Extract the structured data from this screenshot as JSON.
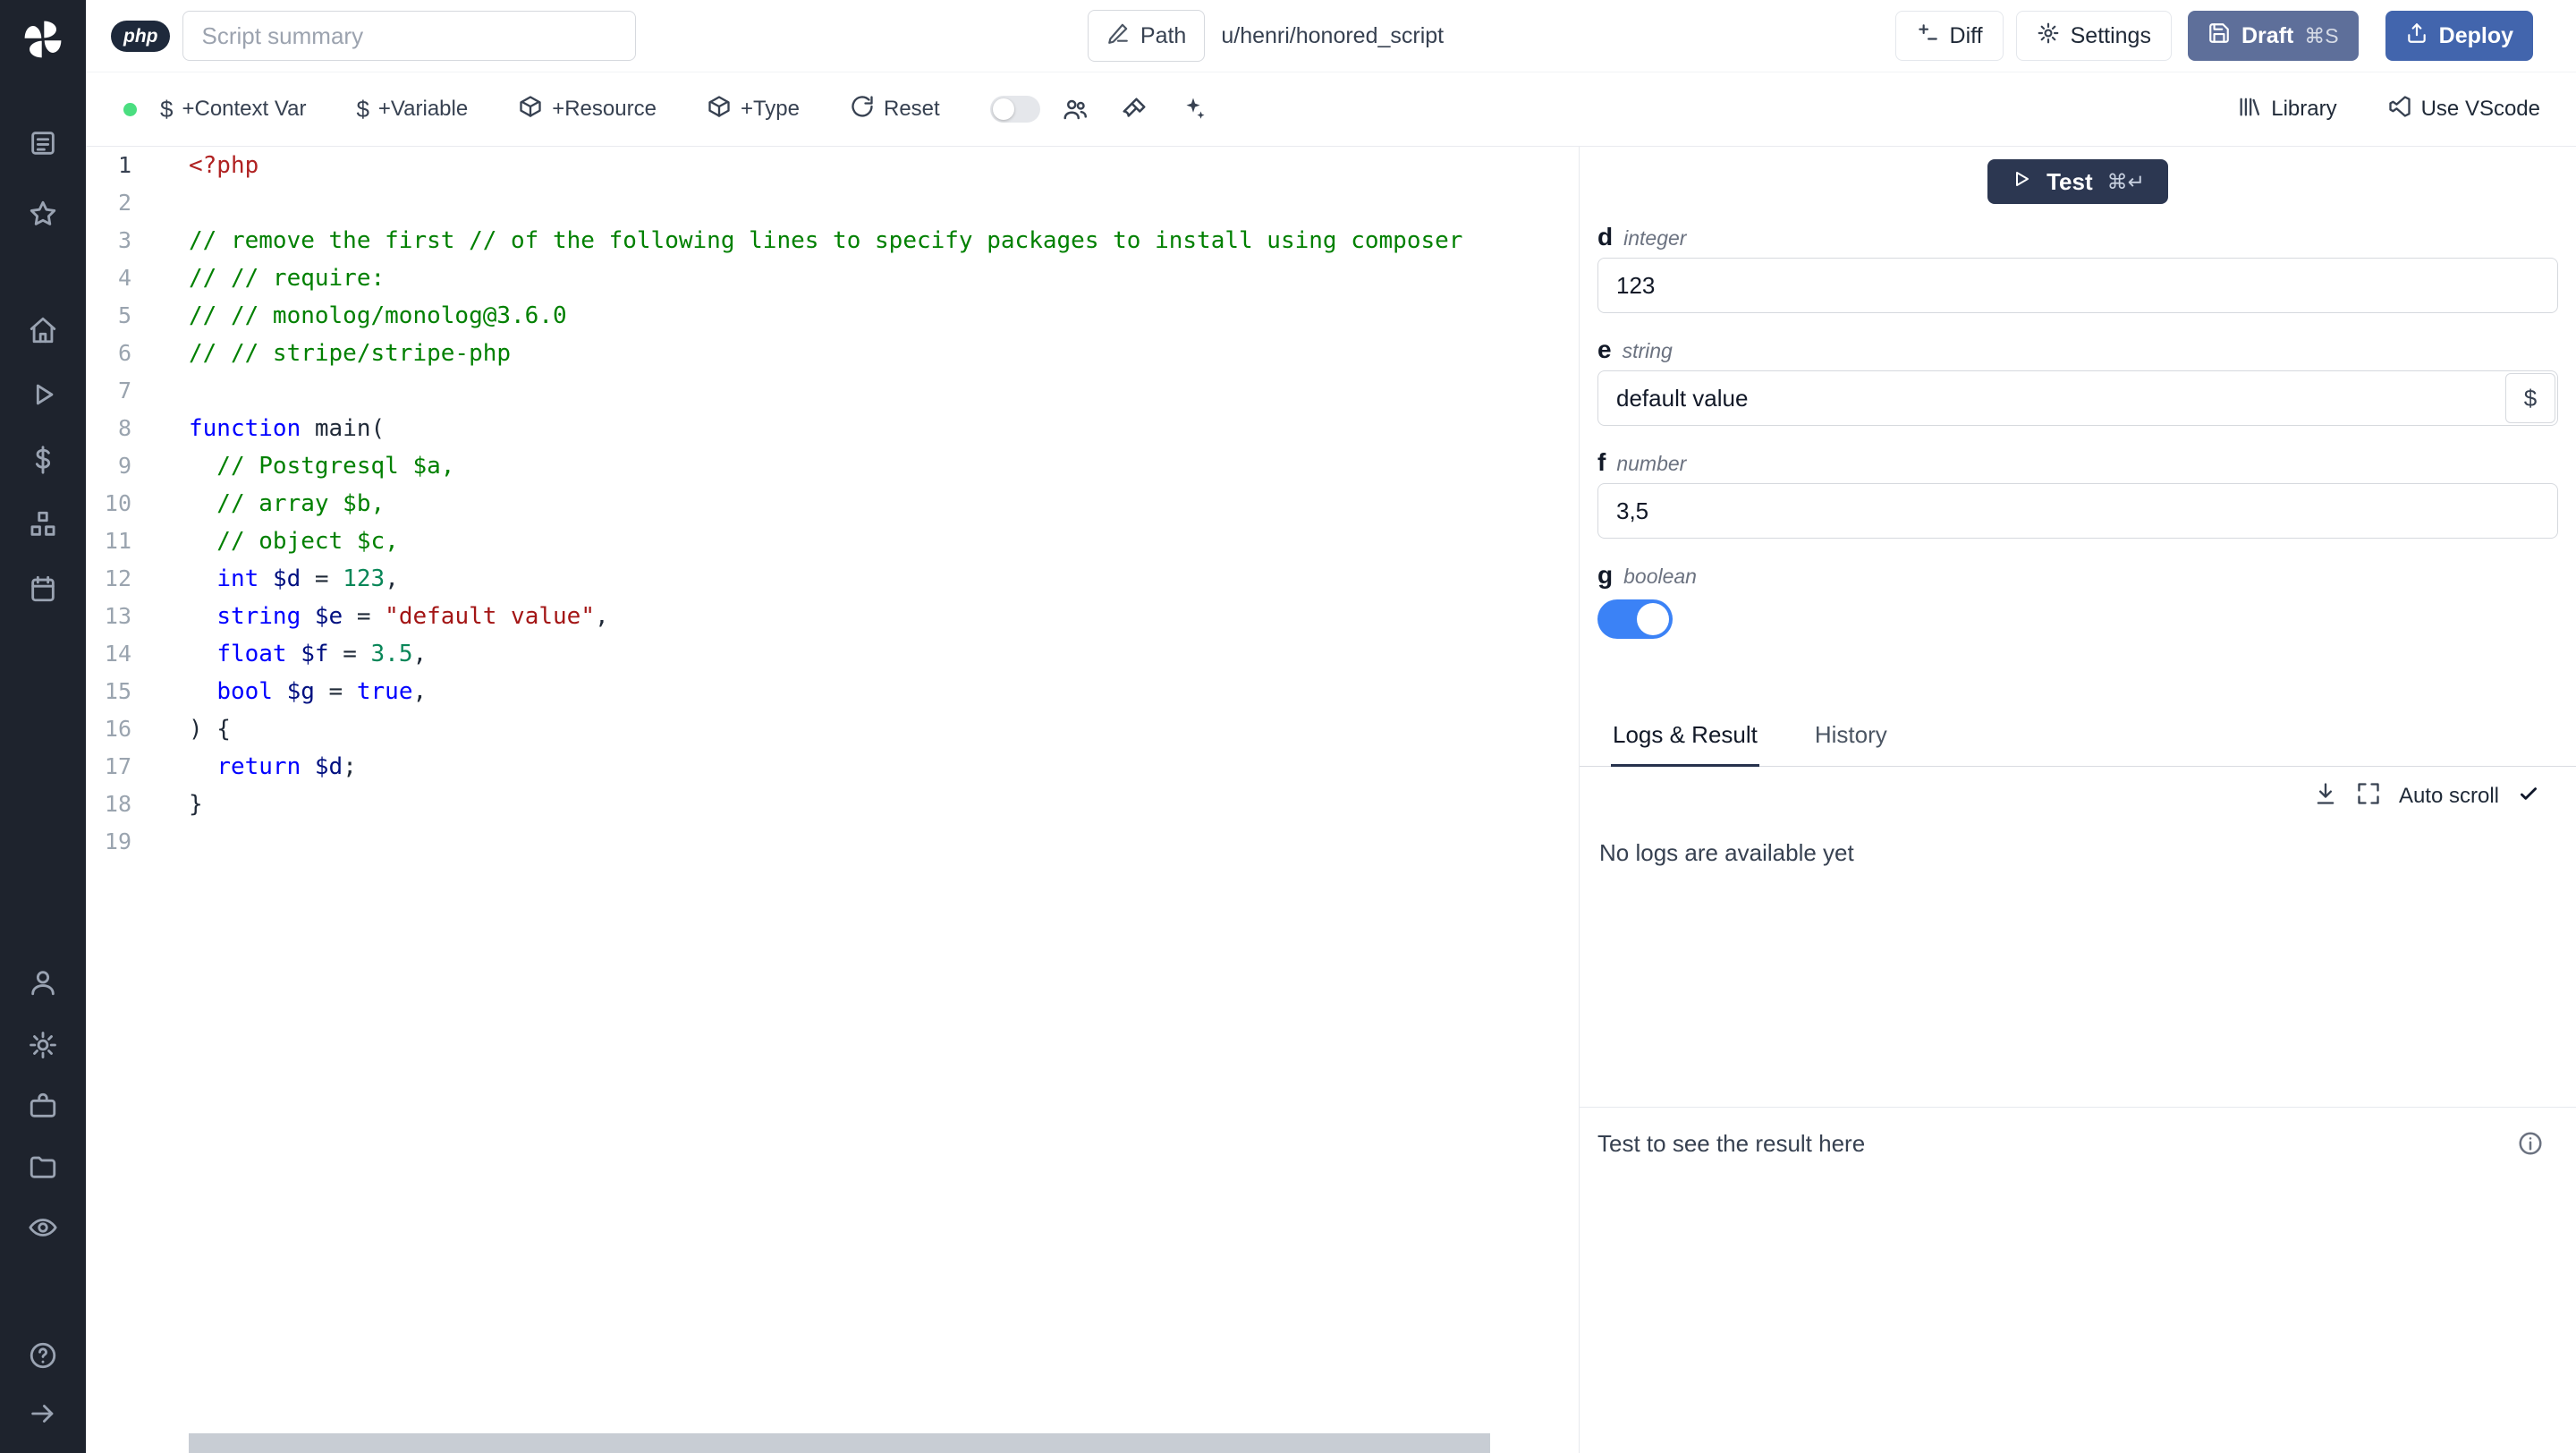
{
  "topbar": {
    "language_badge": "php",
    "summary_placeholder": "Script summary",
    "path_label": "Path",
    "path_value": "u/henri/honored_script",
    "diff_label": "Diff",
    "settings_label": "Settings",
    "draft_label": "Draft",
    "draft_shortcut": "⌘S",
    "deploy_label": "Deploy"
  },
  "toolbar": {
    "context_var_label": "+Context Var",
    "variable_label": "+Variable",
    "resource_label": "+Resource",
    "type_label": "+Type",
    "reset_label": "Reset",
    "library_label": "Library",
    "vscode_label": "Use VScode"
  },
  "sidebar_icons": [
    "windmill-logo",
    "apps",
    "favorites",
    "home",
    "runs",
    "variables",
    "resources",
    "schedules",
    "user",
    "settings",
    "workers",
    "folders",
    "audit-logs",
    "help",
    "collapse-sidebar"
  ],
  "editor": {
    "language": "php",
    "lines": [
      [
        {
          "c": "tag",
          "t": "<?php"
        }
      ],
      [],
      [
        {
          "c": "comment",
          "t": "// remove the first // of the following lines to specify packages to install using composer"
        }
      ],
      [
        {
          "c": "comment",
          "t": "// // require:"
        }
      ],
      [
        {
          "c": "comment",
          "t": "// // monolog/monolog@3.6.0"
        }
      ],
      [
        {
          "c": "comment",
          "t": "// // stripe/stripe-php"
        }
      ],
      [],
      [
        {
          "c": "keyword",
          "t": "function"
        },
        {
          "c": "plain",
          "t": " main("
        }
      ],
      [
        {
          "c": "comment",
          "t": "  // Postgresql $a,"
        }
      ],
      [
        {
          "c": "comment",
          "t": "  // array $b,"
        }
      ],
      [
        {
          "c": "comment",
          "t": "  // object $c,"
        }
      ],
      [
        {
          "c": "plain",
          "t": "  "
        },
        {
          "c": "keyword",
          "t": "int"
        },
        {
          "c": "plain",
          "t": " "
        },
        {
          "c": "var",
          "t": "$d"
        },
        {
          "c": "plain",
          "t": " = "
        },
        {
          "c": "num",
          "t": "123"
        },
        {
          "c": "plain",
          "t": ","
        }
      ],
      [
        {
          "c": "plain",
          "t": "  "
        },
        {
          "c": "keyword",
          "t": "string"
        },
        {
          "c": "plain",
          "t": " "
        },
        {
          "c": "var",
          "t": "$e"
        },
        {
          "c": "plain",
          "t": " = "
        },
        {
          "c": "str",
          "t": "\"default value\""
        },
        {
          "c": "plain",
          "t": ","
        }
      ],
      [
        {
          "c": "plain",
          "t": "  "
        },
        {
          "c": "keyword",
          "t": "float"
        },
        {
          "c": "plain",
          "t": " "
        },
        {
          "c": "var",
          "t": "$f"
        },
        {
          "c": "plain",
          "t": " = "
        },
        {
          "c": "num",
          "t": "3.5"
        },
        {
          "c": "plain",
          "t": ","
        }
      ],
      [
        {
          "c": "plain",
          "t": "  "
        },
        {
          "c": "keyword",
          "t": "bool"
        },
        {
          "c": "plain",
          "t": " "
        },
        {
          "c": "var",
          "t": "$g"
        },
        {
          "c": "plain",
          "t": " = "
        },
        {
          "c": "keyword",
          "t": "true"
        },
        {
          "c": "plain",
          "t": ","
        }
      ],
      [
        {
          "c": "plain",
          "t": ") {"
        }
      ],
      [
        {
          "c": "plain",
          "t": "  "
        },
        {
          "c": "keyword",
          "t": "return"
        },
        {
          "c": "plain",
          "t": " "
        },
        {
          "c": "var",
          "t": "$d"
        },
        {
          "c": "plain",
          "t": ";"
        }
      ],
      [
        {
          "c": "plain",
          "t": "}"
        }
      ],
      []
    ]
  },
  "panel": {
    "test_label": "Test",
    "test_shortcut": "⌘↵",
    "fields": [
      {
        "name": "d",
        "type": "integer",
        "kind": "input",
        "value": "123"
      },
      {
        "name": "e",
        "type": "string",
        "kind": "input-dollar",
        "value": "default value"
      },
      {
        "name": "f",
        "type": "number",
        "kind": "input",
        "value": "3,5"
      },
      {
        "name": "g",
        "type": "boolean",
        "kind": "toggle",
        "value": true
      }
    ],
    "tabs": [
      {
        "label": "Logs & Result",
        "active": true
      },
      {
        "label": "History",
        "active": false
      }
    ],
    "auto_scroll_label": "Auto scroll",
    "no_logs_text": "No logs are available yet",
    "result_placeholder": "Test to see the result here"
  },
  "colors": {
    "accent_blue": "#3b82f6",
    "deploy_blue": "#4265ad",
    "draft_blue": "#5e6f9a",
    "test_navy": "#2c3751",
    "status_green": "#4ade80",
    "sparkles_purple": "#8b5cf6",
    "sidebar_dark": "#1e232d"
  }
}
